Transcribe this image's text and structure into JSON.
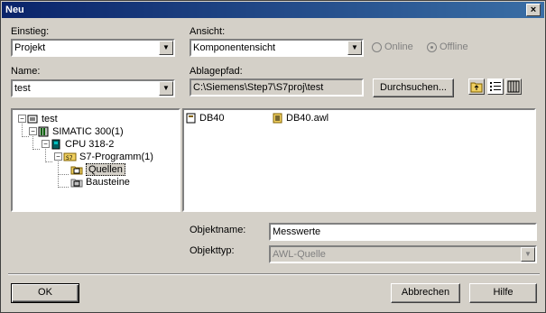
{
  "window": {
    "title": "Neu",
    "close_glyph": "×"
  },
  "einstieg": {
    "label": "Einstieg:",
    "value": "Projekt"
  },
  "ansicht": {
    "label": "Ansicht:",
    "value": "Komponentensicht"
  },
  "online": {
    "label": "Online",
    "selected": false
  },
  "offline": {
    "label": "Offline",
    "selected": true
  },
  "name": {
    "label": "Name:",
    "value": "test"
  },
  "ablagepfad": {
    "label": "Ablagepfad:",
    "value": "C:\\Siemens\\Step7\\S7proj\\test",
    "browse_label": "Durchsuchen..."
  },
  "tree": [
    {
      "label": "test",
      "icon": "project-icon"
    },
    {
      "label": "SIMATIC 300(1)",
      "icon": "station-icon"
    },
    {
      "label": "CPU 318-2",
      "icon": "cpu-icon"
    },
    {
      "label": "S7-Programm(1)",
      "icon": "s7-program-icon"
    },
    {
      "label": "Quellen",
      "icon": "sources-folder-icon"
    },
    {
      "label": "Bausteine",
      "icon": "blocks-folder-icon"
    }
  ],
  "files": [
    {
      "label": "DB40",
      "icon": "db-icon"
    },
    {
      "label": "DB40.awl",
      "icon": "awl-file-icon"
    }
  ],
  "objektname": {
    "label": "Objektname:",
    "value": "Messwerte"
  },
  "objekttyp": {
    "label": "Objekttyp:",
    "value": "AWL-Quelle"
  },
  "buttons": {
    "ok": "OK",
    "abbrechen": "Abbrechen",
    "hilfe": "Hilfe"
  }
}
